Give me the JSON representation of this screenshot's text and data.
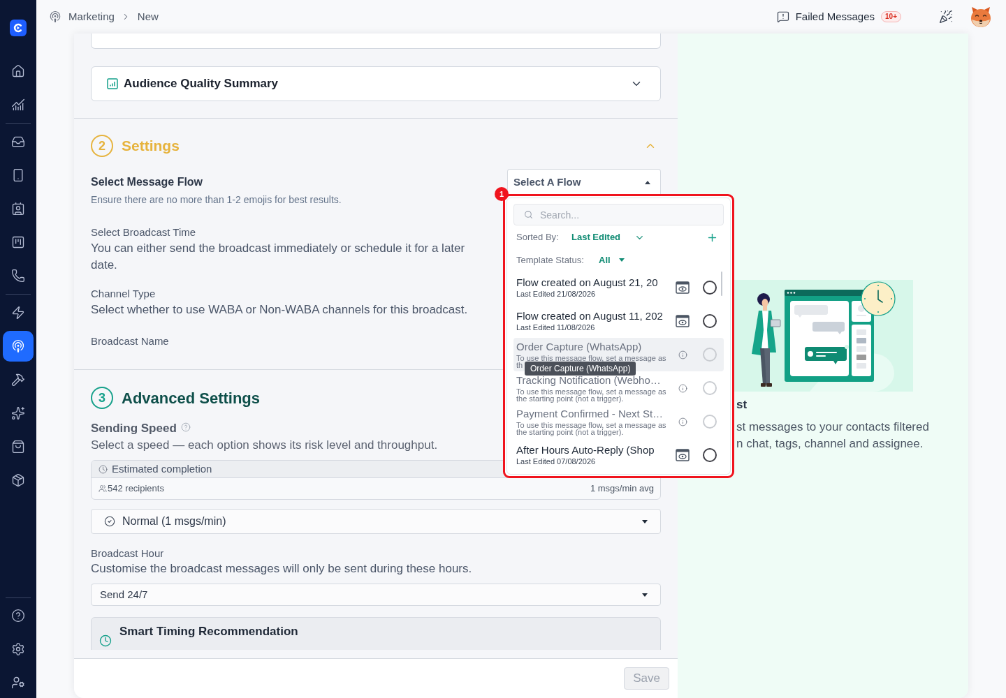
{
  "header": {
    "breadcrumb": [
      {
        "label": "Marketing"
      },
      {
        "label": "New"
      }
    ],
    "failed_messages": {
      "label": "Failed Messages",
      "badge": "10+"
    }
  },
  "sidebar": {
    "sections": [
      {
        "items": [
          {
            "selected": false
          },
          {
            "selected": false
          }
        ]
      },
      {
        "items": [
          {
            "selected": false
          },
          {
            "selected": false
          },
          {
            "selected": false
          },
          {
            "selected": false
          },
          {
            "selected": false
          }
        ]
      },
      {
        "items": [
          {
            "selected": false
          },
          {
            "selected": true
          },
          {
            "selected": false
          },
          {
            "selected": false
          },
          {
            "selected": false
          },
          {
            "selected": false
          }
        ]
      },
      {
        "items": [
          {
            "selected": false
          },
          {
            "selected": false
          },
          {
            "selected": false
          }
        ]
      }
    ]
  },
  "audience_section": {
    "cards": [
      {
        "title": "Audience Quality Summary",
        "expanded": false
      }
    ]
  },
  "settings_section": {
    "number": "2",
    "title": "Settings",
    "color": "#e6b33d",
    "expanded": true,
    "flow_select": {
      "value": "Select A Flow",
      "open": true
    },
    "fields": [
      {
        "kind": "primary",
        "label": "Select Message Flow",
        "description": "Ensure there are no more than 1-2 emojis for best results."
      },
      {
        "kind": "secondary",
        "label": "Select Broadcast Time",
        "description": "You can either send the broadcast immediately or schedule it for a later date."
      },
      {
        "kind": "secondary",
        "label": "Channel Type",
        "description": "Select whether to use WABA or Non-WABA channels for this broadcast."
      },
      {
        "kind": "secondary",
        "label": "Broadcast Name"
      }
    ]
  },
  "advanced_section": {
    "number": "3",
    "title": "Advanced Settings",
    "color": "#15a08a",
    "sending_speed": {
      "label": "Sending Speed",
      "description": "Select a speed — each option shows its risk level and throughput.",
      "estimate": {
        "title": "Estimated completion",
        "recipients": "542 recipients",
        "rate": "1 msgs/min avg"
      },
      "speed_select": {
        "value": "Normal (1 msgs/min)"
      }
    },
    "broadcast_hour": {
      "label": "Broadcast Hour",
      "description": "Customise the broadcast messages will only be sent during these hours.",
      "hour_select": {
        "value": "Send 24/7"
      }
    },
    "smart_timing": {
      "title": "Smart Timing Recommendation"
    }
  },
  "footer": {
    "save_button": {
      "label": "Save",
      "disabled": true
    }
  },
  "info_panel": {
    "title": "st",
    "description_lines": [
      "st messages to your contacts filtered",
      "n chat, tags, channel and assignee."
    ]
  },
  "flow_picker": {
    "search": {
      "placeholder": "Search..."
    },
    "sort": {
      "label": "Sorted By:",
      "value": "Last Edited"
    },
    "status_filter": {
      "label": "Template Status:",
      "value": "All"
    },
    "flows": [
      {
        "title": "Flow created on August 21, 20",
        "subtitle": "Last Edited 21/08/2026",
        "disabled": false,
        "hovered": false,
        "selected": false
      },
      {
        "title": "Flow created on August 11, 202",
        "subtitle": "Last Edited 11/08/2026",
        "disabled": false,
        "hovered": false,
        "selected": false
      },
      {
        "title": "Order Capture (WhatsApp)",
        "description_lines": [
          "To use this message flow, set a message as",
          "th"
        ],
        "disabled": true,
        "hovered": true,
        "selected": false,
        "tooltip": "Order Capture (WhatsApp)"
      },
      {
        "title": "Tracking Notification (Webho…",
        "description_lines": [
          "To use this message flow, set a message as",
          "the starting point (not a trigger)."
        ],
        "disabled": true,
        "hovered": false,
        "selected": false
      },
      {
        "title": "Payment Confirmed - Next St…",
        "description_lines": [
          "To use this message flow, set a message as",
          "the starting point (not a trigger)."
        ],
        "disabled": true,
        "hovered": false,
        "selected": false
      },
      {
        "title": "After Hours Auto-Reply (Shop",
        "subtitle": "Last Edited 07/08/2026",
        "disabled": false,
        "hovered": false,
        "selected": false
      }
    ]
  },
  "annotation": {
    "number": "1"
  }
}
